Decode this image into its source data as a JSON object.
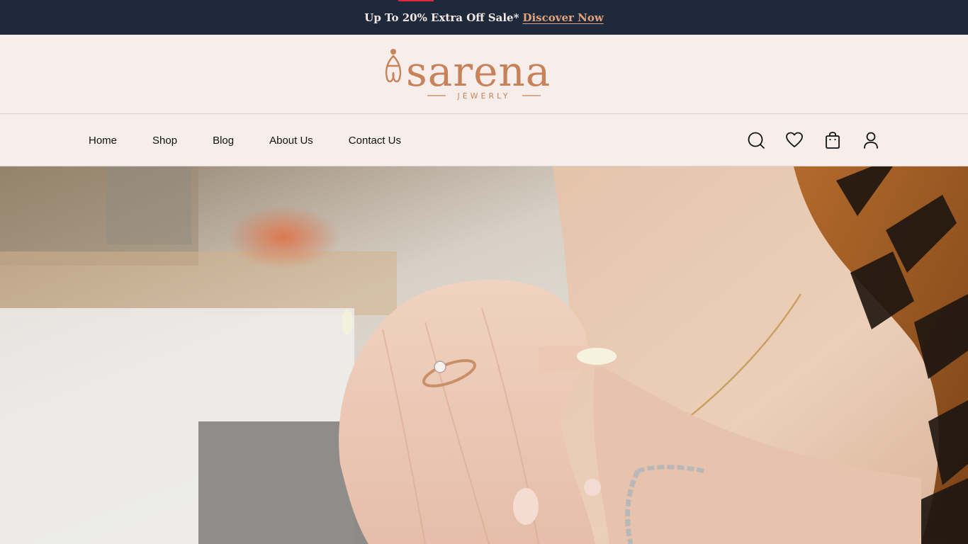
{
  "promo": {
    "text": "Up To 20% Extra Off Sale*",
    "link_label": "Discover Now"
  },
  "brand": {
    "name": "sarena",
    "tagline": "JEWERLY",
    "color": "#c8825a"
  },
  "nav": {
    "items": [
      {
        "label": "Home"
      },
      {
        "label": "Shop"
      },
      {
        "label": "Blog"
      },
      {
        "label": "About Us"
      },
      {
        "label": "Contact Us"
      }
    ],
    "icons": [
      "search-icon",
      "heart-icon",
      "bag-icon",
      "user-icon"
    ]
  },
  "colors": {
    "promo_bg": "#1e293b",
    "page_bg": "#f7eeec",
    "accent": "#e2a37c"
  }
}
